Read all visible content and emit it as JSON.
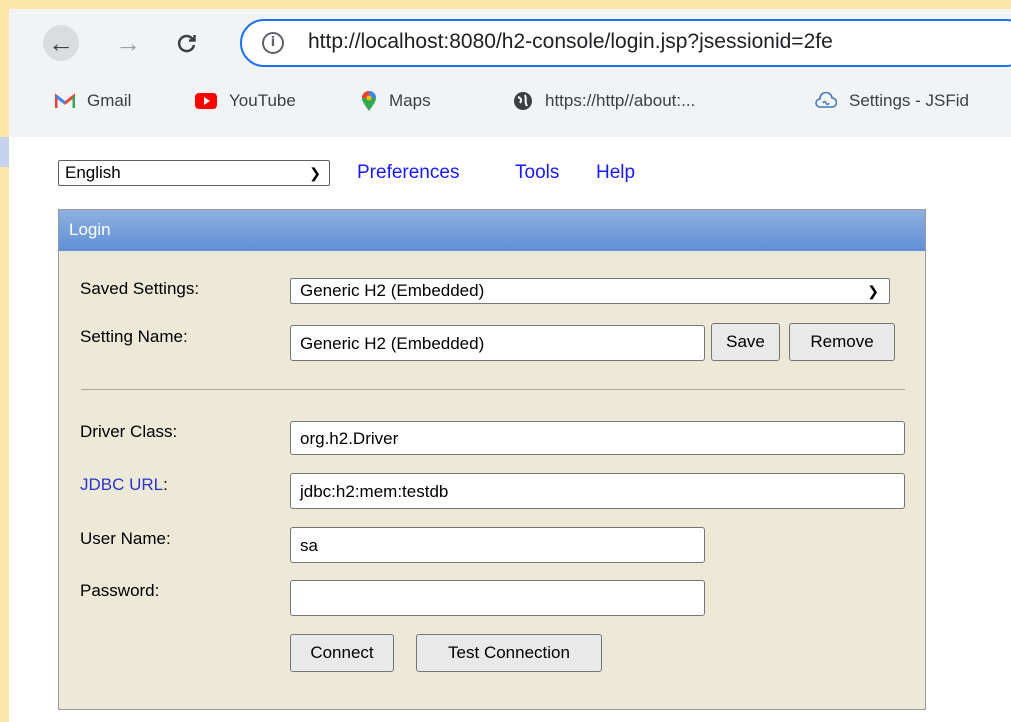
{
  "browser": {
    "url": "http://localhost:8080/h2-console/login.jsp?jsessionid=2fe",
    "bookmarks": [
      {
        "label": "Gmail",
        "icon": "gmail-icon"
      },
      {
        "label": "YouTube",
        "icon": "youtube-icon"
      },
      {
        "label": "Maps",
        "icon": "maps-icon"
      },
      {
        "label": "https://http//about:...",
        "icon": "globe-icon"
      },
      {
        "label": "Settings - JSFid",
        "icon": "jsfiddle-icon"
      }
    ]
  },
  "toolbar": {
    "language": "English",
    "links": {
      "preferences": "Preferences",
      "tools": "Tools",
      "help": "Help"
    }
  },
  "login": {
    "title": "Login",
    "saved_settings_label": "Saved Settings:",
    "saved_settings_value": "Generic H2 (Embedded)",
    "setting_name_label": "Setting Name:",
    "setting_name_value": "Generic H2 (Embedded)",
    "save_label": "Save",
    "remove_label": "Remove",
    "driver_class_label": "Driver Class:",
    "driver_class_value": "org.h2.Driver",
    "jdbc_url_label": "JDBC URL",
    "jdbc_url_colon": ":",
    "jdbc_url_value": "jdbc:h2:mem:testdb",
    "user_name_label": "User Name:",
    "user_name_value": "sa",
    "password_label": "Password:",
    "password_value": "",
    "connect_label": "Connect",
    "test_connection_label": "Test Connection"
  },
  "colors": {
    "panel_bg": "#ece9d8",
    "header_gradient_top": "#8fb0df",
    "header_gradient_bottom": "#5e8fd7",
    "link": "#1a1aff",
    "address_focus": "#1a73e8"
  }
}
